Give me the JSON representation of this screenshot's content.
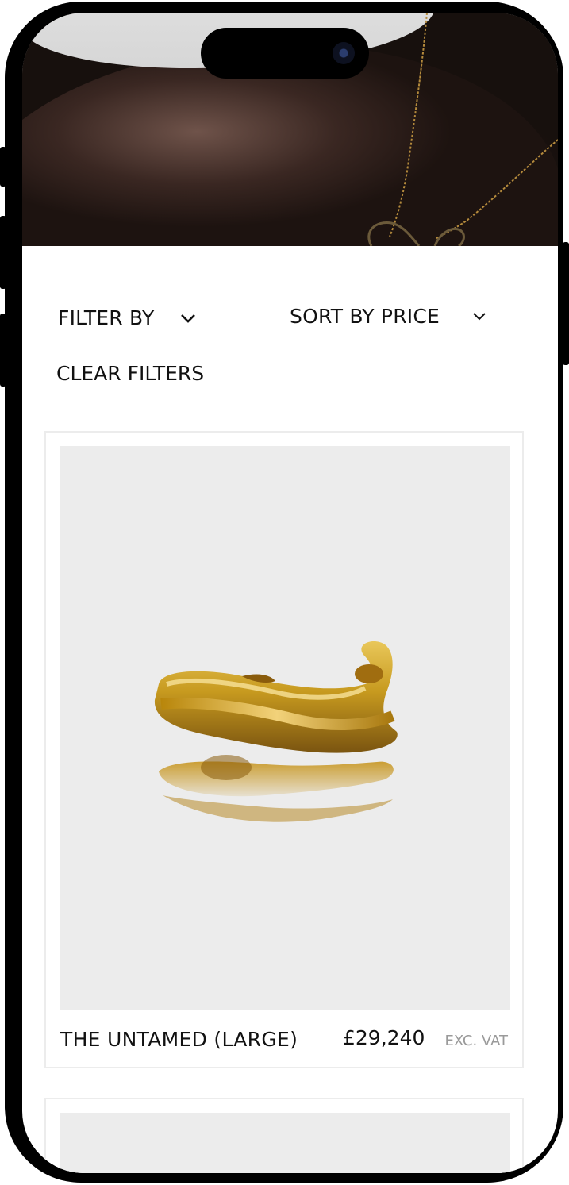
{
  "filters": {
    "filter_by_label": "FILTER BY",
    "sort_by_label": "SORT BY PRICE",
    "clear_filters_label": "CLEAR FILTERS"
  },
  "products": [
    {
      "name": "THE UNTAMED (LARGE)",
      "price": "£29,240",
      "vat_note": "EXC. VAT",
      "image": "gold-cuff-bracelet"
    }
  ],
  "icons": {
    "filter_chevron": "chevron-down-icon",
    "sort_chevron": "chevron-down-icon"
  },
  "colors": {
    "text": "#111111",
    "muted": "#9a9a9a",
    "card_border": "#ececec",
    "image_bg": "#ececec",
    "gold": "#c9a227"
  }
}
